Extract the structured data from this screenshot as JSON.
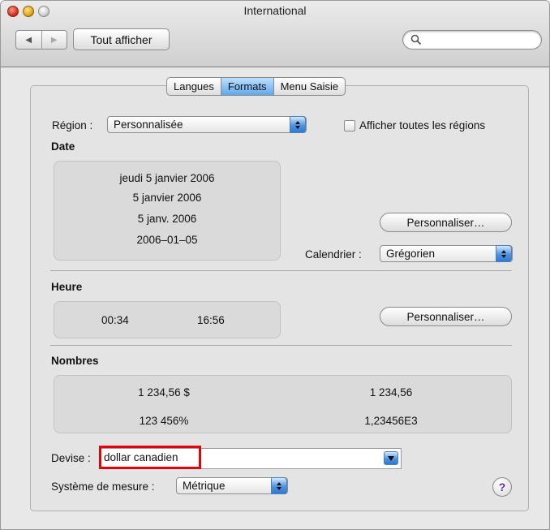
{
  "window": {
    "title": "International"
  },
  "toolbar": {
    "back_icon": "back-arrow-icon",
    "forward_icon": "forward-arrow-icon",
    "show_all_label": "Tout afficher",
    "search_value": ""
  },
  "tabs": [
    {
      "label": "Langues",
      "active": false
    },
    {
      "label": "Formats",
      "active": true
    },
    {
      "label": "Menu Saisie",
      "active": false
    }
  ],
  "region": {
    "label": "Région :",
    "value": "Personnalisée",
    "show_all_label": "Afficher toutes les régions",
    "show_all_checked": false
  },
  "date": {
    "heading": "Date",
    "samples": [
      "jeudi 5 janvier 2006",
      "5 janvier 2006",
      "5 janv. 2006",
      "2006–01–05"
    ],
    "customize_label": "Personnaliser…",
    "calendar_label": "Calendrier :",
    "calendar_value": "Grégorien"
  },
  "time": {
    "heading": "Heure",
    "short": "00:34",
    "long": "16:56",
    "customize_label": "Personnaliser…"
  },
  "numbers": {
    "heading": "Nombres",
    "currency_sample": "1 234,56 $",
    "decimal_sample": "1 234,56",
    "percent_sample": "123 456%",
    "scientific_sample": "1,23456E3"
  },
  "currency": {
    "label": "Devise :",
    "value": "dollar canadien"
  },
  "measure": {
    "label": "Système de mesure :",
    "value": "Métrique"
  },
  "help_label": "?",
  "colors": {
    "highlight": "#e3000f",
    "accent": "#5fa7ea"
  }
}
